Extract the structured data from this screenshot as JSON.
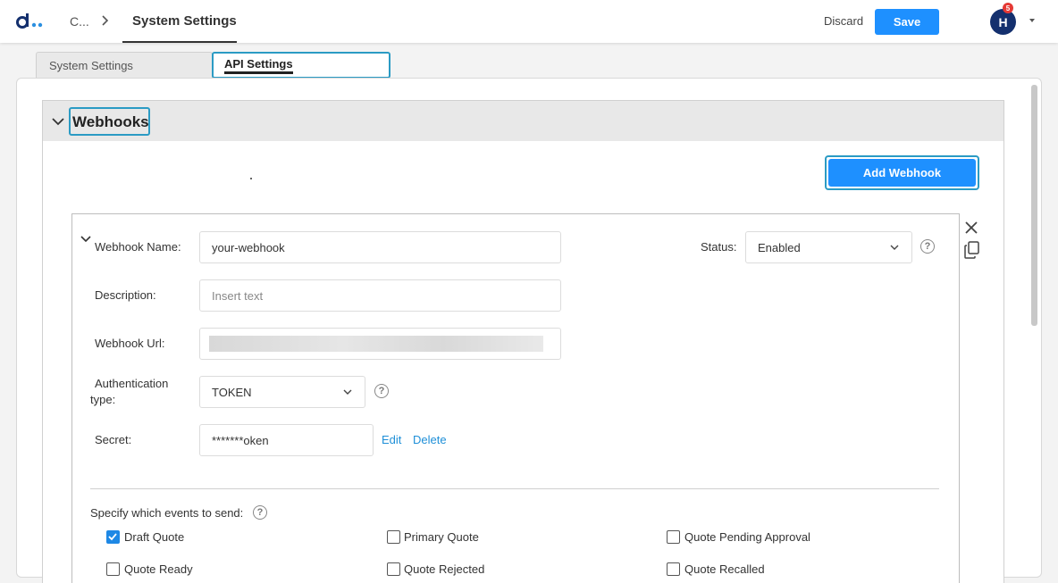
{
  "header": {
    "breadcrumb_first": "C...",
    "title": "System Settings",
    "discard_label": "Discard",
    "save_label": "Save",
    "avatar_initial": "H",
    "notification_count": "5"
  },
  "tabs": [
    {
      "label": "System Settings",
      "active": false
    },
    {
      "label": "API Settings",
      "active": true
    }
  ],
  "section": {
    "title": "Webhooks",
    "add_button_label": "Add Webhook"
  },
  "webhook": {
    "name_label": "Webhook Name:",
    "name_value": "your-webhook",
    "status_label": "Status:",
    "status_value": "Enabled",
    "description_label": "Description:",
    "description_placeholder": "Insert text",
    "url_label": "Webhook Url:",
    "auth_label_line1": "Authentication",
    "auth_label_line2": "type:",
    "auth_value": "TOKEN",
    "secret_label": "Secret:",
    "secret_value": "*******oken",
    "edit_label": "Edit",
    "delete_label": "Delete",
    "events_label": "Specify which events to send:",
    "events": [
      {
        "label": "Draft Quote",
        "checked": true
      },
      {
        "label": "Primary Quote",
        "checked": false
      },
      {
        "label": "Quote Pending Approval",
        "checked": false
      },
      {
        "label": "Quote Ready",
        "checked": false
      },
      {
        "label": "Quote Rejected",
        "checked": false
      },
      {
        "label": "Quote Recalled",
        "checked": false
      }
    ]
  },
  "colors": {
    "accent": "#1e90ff",
    "focus_ring": "#2b9bc4",
    "avatar": "#14306e",
    "badge": "#e53935"
  }
}
